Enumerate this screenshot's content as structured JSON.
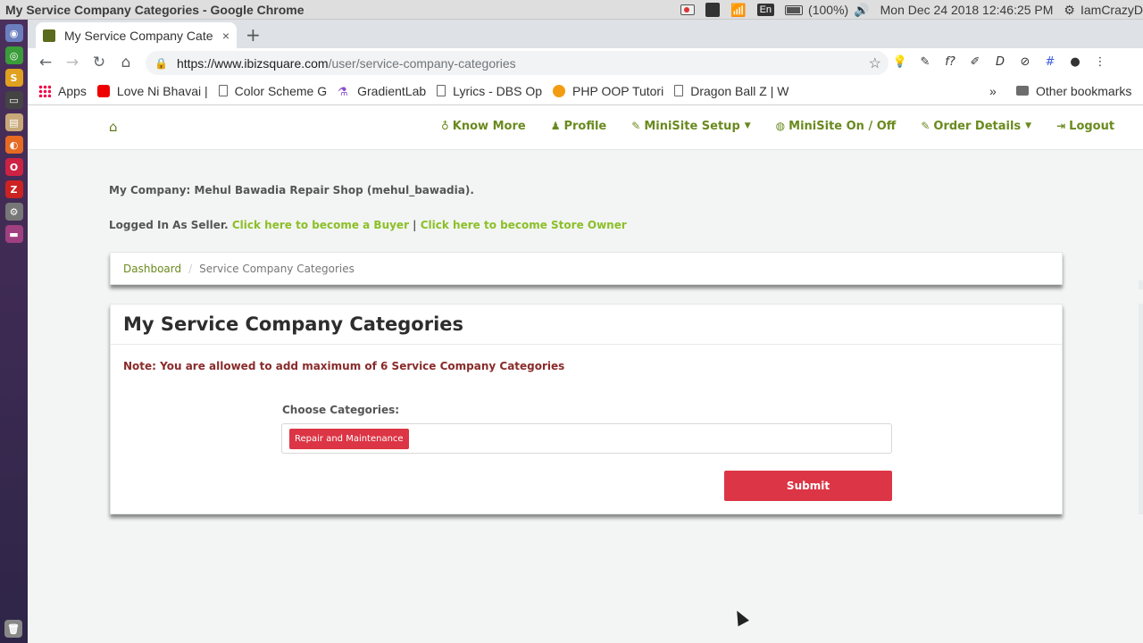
{
  "os": {
    "window_title": "My Service Company Categories - Google Chrome",
    "keyboard": "En",
    "battery": "(100%)",
    "datetime": "Mon Dec 24 2018 12:46:25 PM",
    "username": "IamCrazyD"
  },
  "browser": {
    "tab_title": "My Service Company Cate",
    "tab_close": "×",
    "new_tab": "+",
    "url_host": "https://www.ibizsquare.com",
    "url_path": "/user/service-company-categories",
    "bookmarks": [
      {
        "label": "Apps",
        "icon": "apps-grid-icon"
      },
      {
        "label": "Love Ni Bhavai |",
        "icon": "youtube-icon"
      },
      {
        "label": "Color Scheme G",
        "icon": "page-icon"
      },
      {
        "label": "GradientLab",
        "icon": "flask-icon"
      },
      {
        "label": "Lyrics - DBS Op",
        "icon": "page-icon"
      },
      {
        "label": "PHP OOP Tutori",
        "icon": "php-icon"
      },
      {
        "label": "Dragon Ball Z | W",
        "icon": "page-icon"
      }
    ],
    "bookmarks_overflow": "»",
    "other_bookmarks": "Other bookmarks"
  },
  "nav": {
    "items": [
      {
        "label": "Know More",
        "icon": "lightbulb-icon"
      },
      {
        "label": "Profile",
        "icon": "user-icon"
      },
      {
        "label": "MiniSite Setup",
        "icon": "wrench-icon",
        "dropdown": true
      },
      {
        "label": "MiniSite On / Off",
        "icon": "globe-icon"
      },
      {
        "label": "Order Details",
        "icon": "wrench-icon",
        "dropdown": true
      },
      {
        "label": "Logout",
        "icon": "sign-out-icon"
      }
    ]
  },
  "info": {
    "company": "My Company: Mehul Bawadia Repair Shop (mehul_bawadia).",
    "logged_prefix": "Logged In As Seller. ",
    "become_buyer": "Click here to become a Buyer",
    "separator": " | ",
    "become_store_owner": "Click here to become Store Owner"
  },
  "breadcrumb": {
    "home": "Dashboard",
    "separator": "/",
    "current": "Service Company Categories"
  },
  "card": {
    "title": "My Service Company Categories",
    "note": "Note: You are allowed to add maximum of 6 Service Company Categories",
    "choose_label": "Choose Categories:",
    "selected_tag": "Repair and Maintenance",
    "submit_label": "Submit"
  },
  "colors": {
    "accent_green": "#6a8a1e",
    "link_green": "#8cbf26",
    "danger_red": "#dc3545"
  }
}
